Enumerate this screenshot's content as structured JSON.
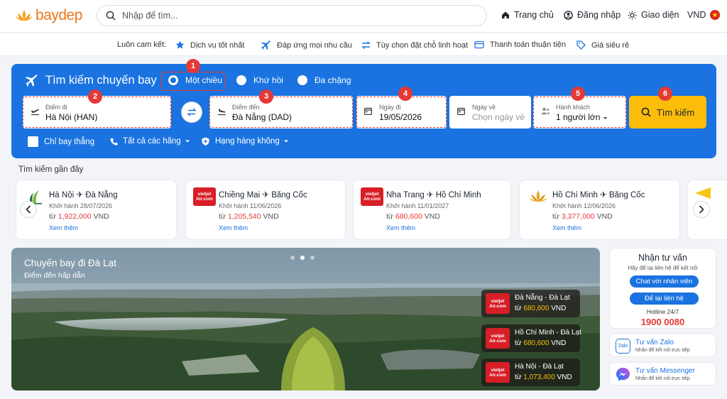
{
  "header": {
    "logo_text": "baydep",
    "search_placeholder": "Nhập để tìm...",
    "nav": {
      "home": "Trang chủ",
      "login": "Đăng nhập",
      "theme": "Giao diện",
      "currency": "VND"
    }
  },
  "commitments": {
    "label": "Luôn cam kết:",
    "items": [
      "Dịch vụ tốt nhất",
      "Đáp ứng mọi nhu cầu",
      "Tùy chọn đặt chỗ linh hoạt",
      "Thanh toán thuận tiện",
      "Giá siêu rẻ"
    ]
  },
  "search_panel": {
    "title": "Tìm kiếm chuyến bay",
    "trip_types": [
      "Một chiều",
      "Khứ hồi",
      "Đa chặng"
    ],
    "selected_trip_type": "Một chiều",
    "from": {
      "label": "Điểm đi",
      "value": "Hà Nội (HAN)"
    },
    "to": {
      "label": "Điểm đến",
      "value": "Đà Nẵng (DAD)"
    },
    "depart": {
      "label": "Ngày đi",
      "value": "19/05/2026"
    },
    "return": {
      "label": "Ngày về",
      "placeholder": "Chọn ngày về"
    },
    "passengers": {
      "label": "Hành khách",
      "value": "1 người lớn"
    },
    "search_button": "Tìm kiếm",
    "options": {
      "direct": "Chỉ bay thẳng",
      "airlines": "Tất cả các hãng",
      "airline_class": "Hạng hàng không"
    },
    "step_badges": [
      "1",
      "2",
      "3",
      "4",
      "5",
      "6"
    ]
  },
  "recent": {
    "title": "Tìm kiếm gần đây",
    "cards": [
      {
        "from": "Hà Nội",
        "to": "Đà Nẵng",
        "departure": "Khởi hành 28/07/2026",
        "price_prefix": "từ",
        "price": "1,922,000",
        "currency": "VND",
        "more": "Xem thêm"
      },
      {
        "from": "Chiềng Mai",
        "to": "Băng Cốc",
        "departure": "Khởi hành 11/06/2026",
        "price_prefix": "từ",
        "price": "1,205,540",
        "currency": "VND",
        "more": "Xem thêm"
      },
      {
        "from": "Nha Trang",
        "to": "Hồ Chí Minh",
        "departure": "Khởi hành 11/01/2027",
        "price_prefix": "từ",
        "price": "680,600",
        "currency": "VND",
        "more": "Xem thêm"
      },
      {
        "from": "Hồ Chí Minh",
        "to": "Băng Cốc",
        "departure": "Khởi hành 12/06/2026",
        "price_prefix": "từ",
        "price": "3,377,000",
        "currency": "VND",
        "more": "Xem thêm"
      }
    ],
    "airline_logo_text": "vietjet Air.com"
  },
  "banner": {
    "title": "Chuyến bay đi Đà Lạt",
    "subtitle": "Điểm đến hấp dẫn",
    "deals": [
      {
        "route": "Đà Nẵng - Đà Lạt",
        "price_prefix": "từ",
        "price": "680,600",
        "currency": "VND"
      },
      {
        "route": "Hồ Chí Minh - Đà Lạt",
        "price_prefix": "từ",
        "price": "680,600",
        "currency": "VND"
      },
      {
        "route": "Hà Nội - Đà Lạt",
        "price_prefix": "từ",
        "price": "1,073,400",
        "currency": "VND"
      }
    ]
  },
  "consult": {
    "title": "Nhận tư vấn",
    "subtitle": "Hãy để lại liên hệ để kết nối",
    "chat_button": "Chat với nhân viên",
    "leave_contact_button": "Để lại liên hệ",
    "hotline_label": "Hotline 24/7",
    "hotline": "1900 0080"
  },
  "contacts": [
    {
      "title": "Tư vấn Zalo",
      "sub": "Nhắn để kết nối trực tiếp",
      "icon_text": "Zalo"
    },
    {
      "title": "Tư vấn Messenger",
      "sub": "Nhắn để kết nối trực tiếp"
    }
  ],
  "colors": {
    "primary": "#1a73e0",
    "accent": "#fbbd09",
    "highlight": "#e53935",
    "brand": "#e8781a"
  }
}
